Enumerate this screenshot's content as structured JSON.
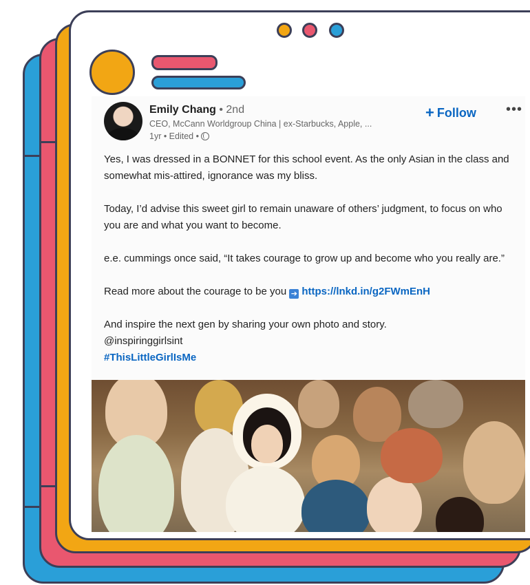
{
  "window_dots": {
    "colors": [
      "#f2a614",
      "#e9576f",
      "#2a9fd8"
    ]
  },
  "post": {
    "author_name": "Emily Chang",
    "connection_degree": " • 2nd",
    "headline": "CEO, McCann Worldgroup China | ex-Starbucks, Apple, ...",
    "meta": "1yr • Edited • ",
    "follow_label": "Follow",
    "follow_icon": "plus-icon",
    "more_icon": "ellipsis-icon",
    "more_label": "•••",
    "paragraphs": [
      "Yes, I was dressed in a BONNET for this school event. As the only Asian in the class and somewhat mis-attired, ignorance was my bliss.",
      "Today, I’d advise this sweet girl to remain unaware of others’ judgment, to focus on who you are and what you want to become.",
      "e.e. cummings once said, “It takes courage to grow up and become who you really are.”"
    ],
    "read_more_text": "Read more about the courage to be you ",
    "read_more_link": "https://lnkd.in/g2FWmEnH",
    "closing_line": "And inspire the next gen by sharing your own photo and story.",
    "mention": "@inspiringgirlsint",
    "hashtag": "#ThisLittleGirlIsMe"
  },
  "colors": {
    "link": "#0a66c2",
    "yellow": "#f2a614",
    "red": "#e9576f",
    "blue": "#2a9fd8",
    "outline": "#3c3f58"
  }
}
